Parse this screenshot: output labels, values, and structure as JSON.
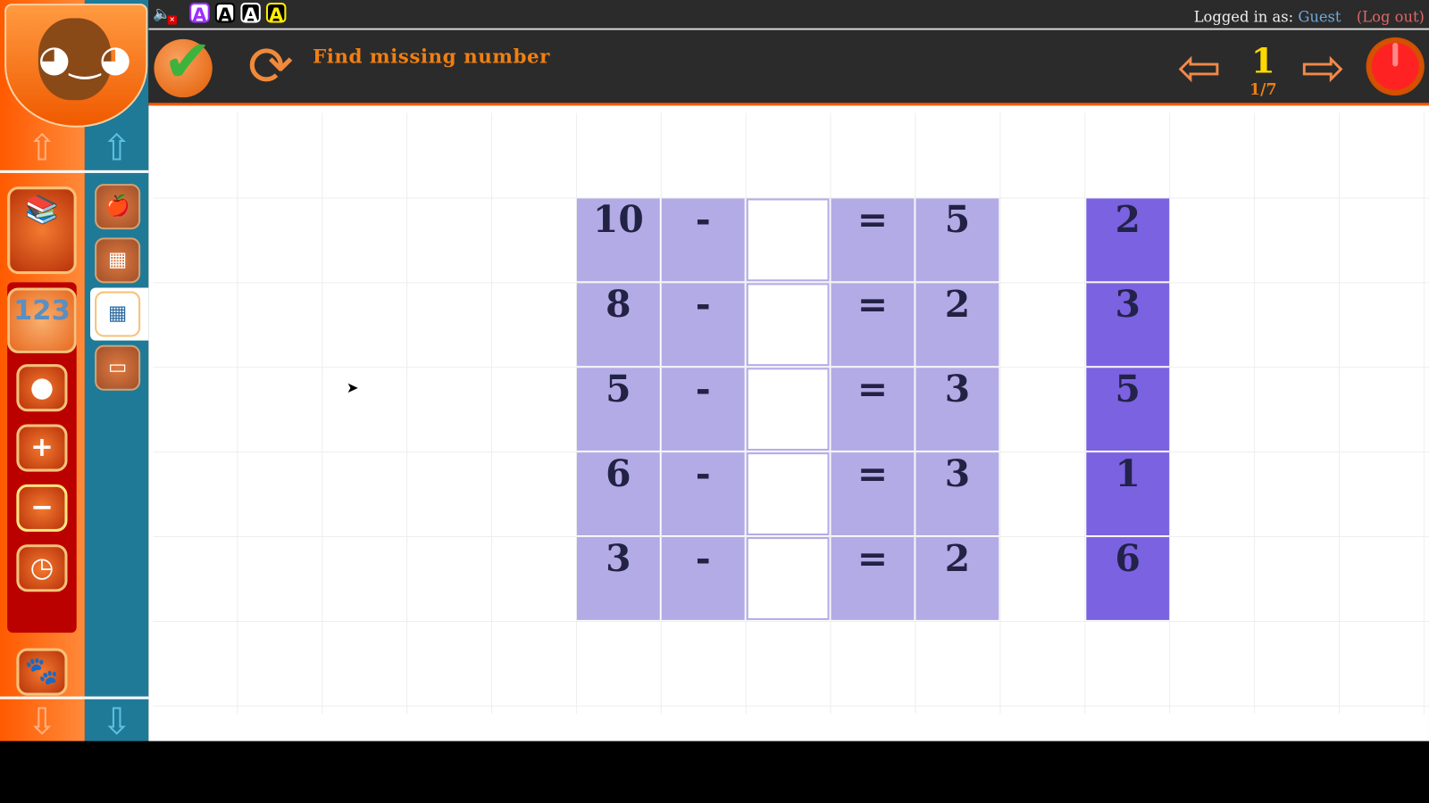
{
  "topbar": {
    "font_buttons": [
      {
        "label": "A",
        "color": "#9b30ff",
        "bg": "#fff",
        "border": "#9b30ff"
      },
      {
        "label": "A",
        "color": "#000",
        "bg": "#fff",
        "border": "#000"
      },
      {
        "label": "A",
        "color": "#fff",
        "bg": "#000",
        "border": "#fff"
      },
      {
        "label": "A",
        "color": "#ffee00",
        "bg": "#000",
        "border": "#ffee00"
      }
    ],
    "logged_in_label": "Logged in as:",
    "user": "Guest",
    "logout": "(Log out)"
  },
  "toolbar": {
    "title": "Find missing number",
    "page": "1",
    "page_fraction": "1/7"
  },
  "sidebar": {
    "categories": [
      {
        "name": "books",
        "glyph": "📚"
      },
      {
        "name": "numbers",
        "glyph": "123"
      },
      {
        "name": "counting",
        "glyph": "●"
      },
      {
        "name": "addition",
        "glyph": "+"
      },
      {
        "name": "subtraction",
        "glyph": "−"
      },
      {
        "name": "clock",
        "glyph": "◷"
      },
      {
        "name": "character",
        "glyph": "🐾"
      }
    ],
    "subcategories": [
      {
        "name": "apples",
        "glyph": "🍎"
      },
      {
        "name": "subtraction-table",
        "glyph": "▦"
      },
      {
        "name": "missing-number",
        "glyph": "▦"
      },
      {
        "name": "subtraction-boxes",
        "glyph": "▭"
      }
    ]
  },
  "equations": [
    {
      "a": "10",
      "op": "-",
      "eq": "=",
      "result": "5",
      "answer": ""
    },
    {
      "a": "8",
      "op": "-",
      "eq": "=",
      "result": "2",
      "answer": ""
    },
    {
      "a": "5",
      "op": "-",
      "eq": "=",
      "result": "3",
      "answer": ""
    },
    {
      "a": "6",
      "op": "-",
      "eq": "=",
      "result": "3",
      "answer": ""
    },
    {
      "a": "3",
      "op": "-",
      "eq": "=",
      "result": "2",
      "answer": ""
    }
  ],
  "answer_options": [
    "2",
    "3",
    "5",
    "1",
    "6"
  ]
}
